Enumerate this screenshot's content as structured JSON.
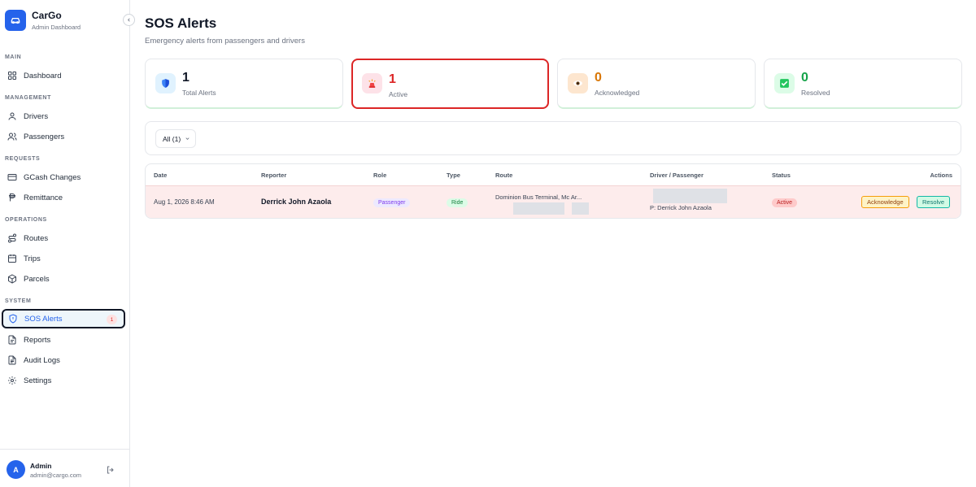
{
  "app": {
    "name": "CarGo",
    "subtitle": "Admin Dashboard"
  },
  "sidebar": {
    "sections": {
      "main": "MAIN",
      "management": "MANAGEMENT",
      "requests": "REQUESTS",
      "operations": "OPERATIONS",
      "system": "SYSTEM"
    },
    "items": {
      "dashboard": "Dashboard",
      "drivers": "Drivers",
      "passengers": "Passengers",
      "gcash": "GCash Changes",
      "remittance": "Remittance",
      "routes": "Routes",
      "trips": "Trips",
      "parcels": "Parcels",
      "sos": "SOS Alerts",
      "reports": "Reports",
      "audit": "Audit Logs",
      "settings": "Settings"
    },
    "sos_badge": "1"
  },
  "user": {
    "initial": "A",
    "name": "Admin",
    "email": "admin@cargo.com"
  },
  "page": {
    "title": "SOS Alerts",
    "subtitle": "Emergency alerts from passengers and drivers"
  },
  "stats": [
    {
      "value": "1",
      "label": "Total Alerts",
      "color": "#111827"
    },
    {
      "value": "1",
      "label": "Active",
      "color": "#dc2626"
    },
    {
      "value": "0",
      "label": "Acknowledged",
      "color": "#d97706"
    },
    {
      "value": "0",
      "label": "Resolved",
      "color": "#16a34a"
    }
  ],
  "filter": {
    "selected": "All (1)"
  },
  "table": {
    "headers": {
      "date": "Date",
      "reporter": "Reporter",
      "role": "Role",
      "type": "Type",
      "route": "Route",
      "driver_passenger": "Driver / Passenger",
      "status": "Status",
      "actions": "Actions"
    },
    "rows": [
      {
        "date": "Aug 1, 2026 8:46 AM",
        "reporter": "Derrick John Azaola",
        "role": "Passenger",
        "type": "Ride",
        "route": "Dominion Bus Terminal, Mc Ar...",
        "passenger": "P: Derrick John Azaola",
        "status": "Active",
        "acknowledge_label": "Acknowledge",
        "resolve_label": "Resolve"
      }
    ]
  },
  "colors": {
    "accent": "#2563eb",
    "danger": "#dc2626",
    "warning": "#d97706",
    "success": "#16a34a"
  }
}
